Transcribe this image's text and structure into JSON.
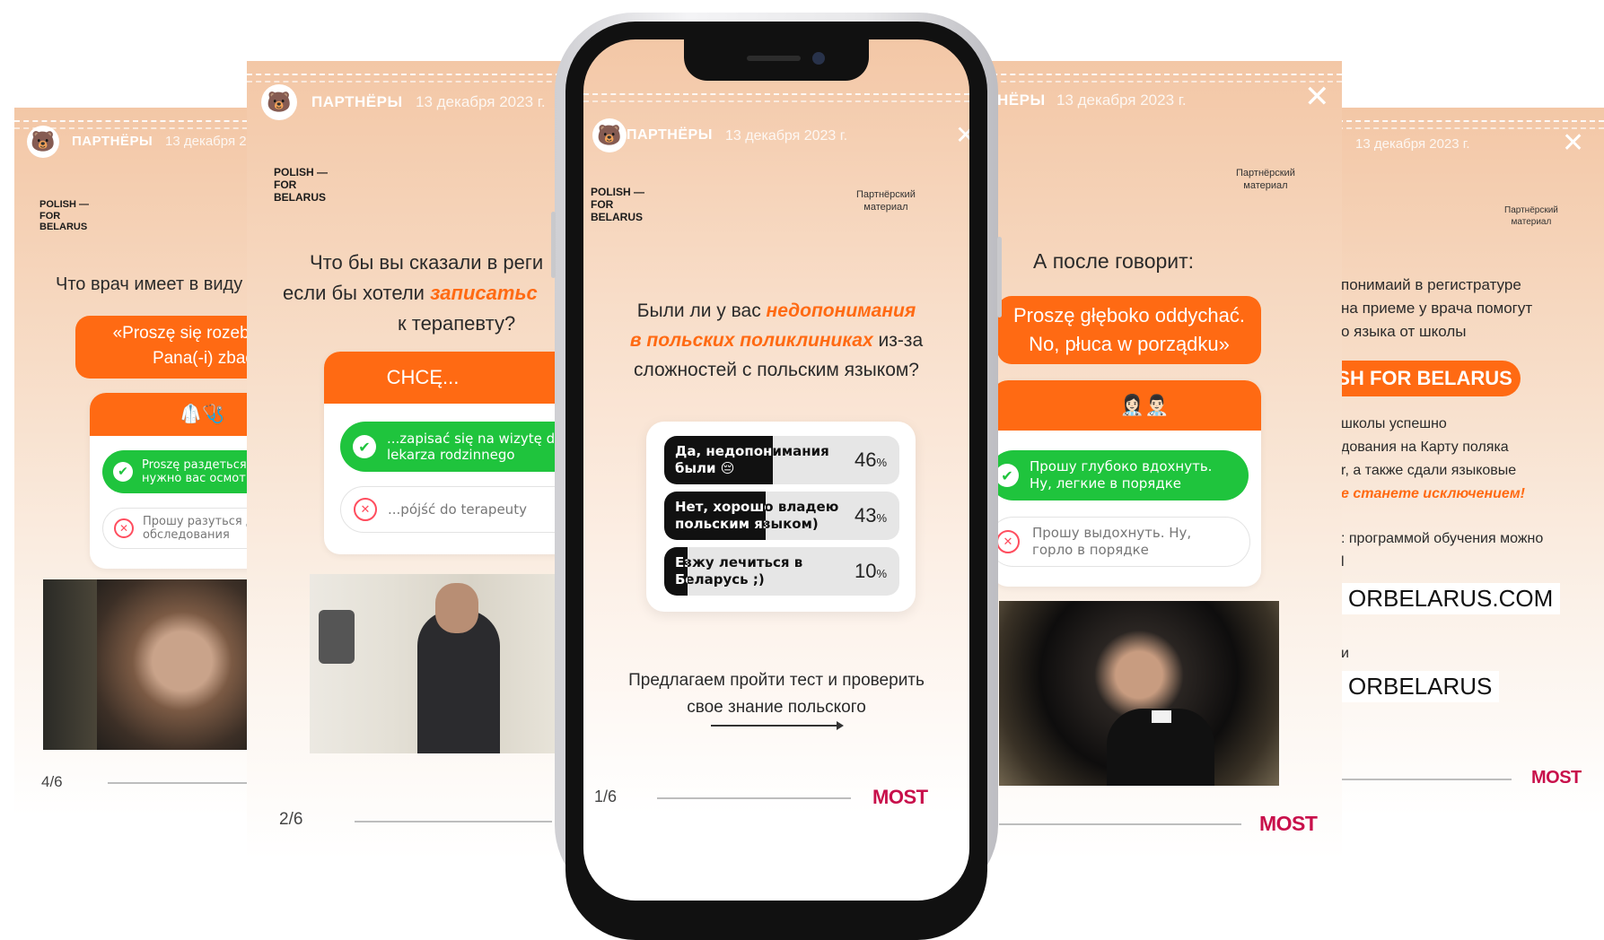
{
  "header": {
    "partner": "ПАРТНЁРЫ",
    "date": "13 декабря 2023 г."
  },
  "brand": "POLISH —\nFOR\nBELARUS",
  "material": "Партнёрский\nматериал",
  "most": "MOST",
  "colors": {
    "accent": "#ff6a13",
    "good": "#1fc43d",
    "bad": "#ff4d5e",
    "most": "#c8104b"
  },
  "story1": {
    "question": "Что врач имеет в виду",
    "quote": "«Proszę się rozebr\nPana(-i) zbad",
    "option_good": "Proszę раздеться\nнужно вас осмот",
    "option_bad": "Прошу разуться д\nобследования",
    "page": "4/6"
  },
  "story2": {
    "q_line1": "Что бы вы сказали в реги",
    "q_line2_pre": "если бы хотели ",
    "q_line2_hl": "записатьс",
    "q_line3": "к терапевту?",
    "quiz_header": "CHCĘ...",
    "option_good": "...zapisać się na wizytę d\nlekarza rodzinnego",
    "option_bad": "...pójść do terapeuty",
    "page": "2/6"
  },
  "story3": {
    "q_line1_pre": "Были ли у вас ",
    "q_line1_hl": "недопонимания",
    "q_line2_hl": "в польских поликлиниках",
    "q_line2_post": " из-за",
    "q_line3": "сложностей с польским языком?",
    "poll": [
      {
        "label": "Да, недопонимания\nбыли 😔",
        "percent": "46",
        "fraction": 0.46
      },
      {
        "label": "Нет, хорошо владею\nпольским языком)",
        "percent": "43",
        "fraction": 0.43
      },
      {
        "label": "Езжу лечиться в\nБеларусь ;)",
        "percent": "10",
        "fraction": 0.1
      }
    ],
    "pct_sign": "%",
    "cta_line1": "Предлагаем пройти тест и проверить",
    "cta_line2": "свое знание польского",
    "arrow": "——————→",
    "page": "1/6"
  },
  "story4": {
    "header_partner": "НЁРЫ",
    "heading": "А после говорит:",
    "quote": "Proszę głęboko oddychać.\nNo, płuca w porządku»",
    "emoji": "👩🏻‍⚕️👨🏻‍⚕️",
    "option_good": "Прошу глубоко вдохнуть.\nНу, легкие в порядке",
    "option_bad": "Прошу выдохнуть. Ну,\nгорло в порядке"
  },
  "story5": {
    "line1": "понимаий в регистратуре",
    "line2": "на приеме у врача помогут",
    "line3": "о языка от школы",
    "badge": "ISH FOR BELARUS",
    "p1": "школы успешно",
    "p2": "дования на Карту поляка",
    "p3": "r, а также сдали языковые",
    "p4": "е станете исключением!",
    "p5": ": программой обучения можно",
    "p6": "l",
    "site": "ORBELARUS.COM",
    "p7": "и",
    "handle": "ORBELARUS"
  }
}
